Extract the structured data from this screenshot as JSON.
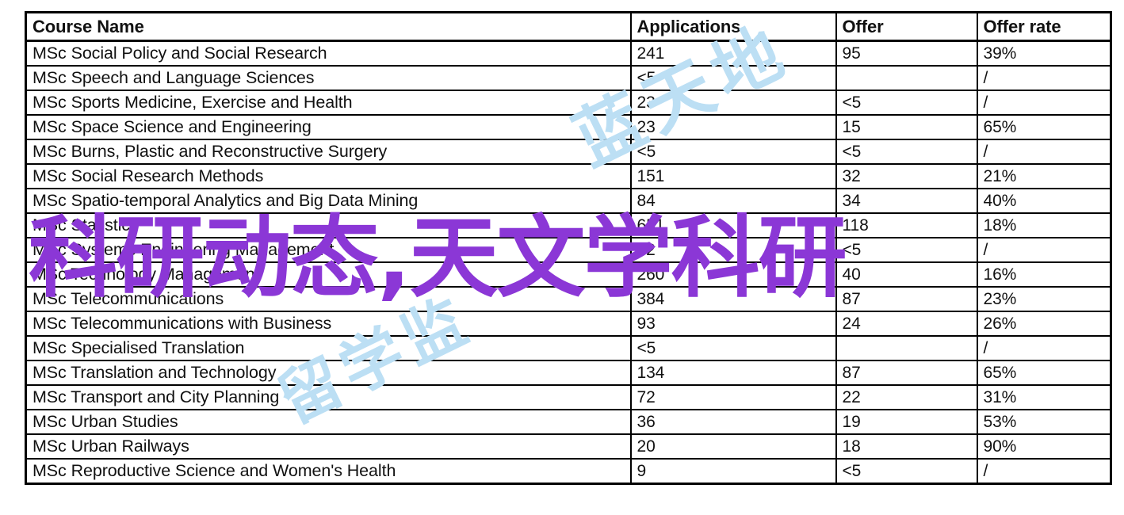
{
  "table": {
    "columns": [
      "Course Name",
      "Applications",
      "Offer",
      "Offer rate"
    ],
    "rows": [
      {
        "name": "MSc Social Policy and Social Research",
        "applications": "241",
        "offer": "95",
        "rate": "39%"
      },
      {
        "name": "MSc Speech and Language Sciences",
        "applications": "<5",
        "offer": "",
        "rate": "/"
      },
      {
        "name": "MSc Sports Medicine, Exercise and Health",
        "applications": "23",
        "offer": "<5",
        "rate": "/"
      },
      {
        "name": "MSc Space Science and Engineering",
        "applications": "23",
        "offer": "15",
        "rate": "65%"
      },
      {
        "name": "MSc Burns, Plastic and Reconstructive Surgery",
        "applications": "<5",
        "offer": "<5",
        "rate": "/"
      },
      {
        "name": "MSc Social Research Methods",
        "applications": "151",
        "offer": "32",
        "rate": "21%"
      },
      {
        "name": "MSc Spatio-temporal Analytics and Big Data Mining",
        "applications": "84",
        "offer": "34",
        "rate": "40%"
      },
      {
        "name": "MSc Statistics",
        "applications": "651",
        "offer": "118",
        "rate": "18%"
      },
      {
        "name": "MSc Systems Engineering Management",
        "applications": "32",
        "offer": "<5",
        "rate": "/"
      },
      {
        "name": "MSc Technology Management",
        "applications": "260",
        "offer": "40",
        "rate": "16%"
      },
      {
        "name": "MSc Telecommunications",
        "applications": "384",
        "offer": "87",
        "rate": "23%"
      },
      {
        "name": "MSc Telecommunications with Business",
        "applications": "93",
        "offer": "24",
        "rate": "26%"
      },
      {
        "name": "MSc Specialised Translation",
        "applications": "<5",
        "offer": "",
        "rate": "/"
      },
      {
        "name": "MSc Translation and Technology",
        "applications": "134",
        "offer": "87",
        "rate": "65%"
      },
      {
        "name": "MSc Transport and City Planning",
        "applications": "72",
        "offer": "22",
        "rate": "31%"
      },
      {
        "name": "MSc Urban Studies",
        "applications": "36",
        "offer": "19",
        "rate": "53%"
      },
      {
        "name": "MSc Urban Railways",
        "applications": "20",
        "offer": "18",
        "rate": "90%"
      },
      {
        "name": "MSc Reproductive Science and Women's Health",
        "applications": "9",
        "offer": "<5",
        "rate": "/"
      }
    ]
  },
  "watermarks": {
    "blue_top": "蓝天地",
    "blue_bottom": "留学监",
    "purple_headline": "科研动态,天文学科研",
    "blue_color": "#bcdff4",
    "purple_color": "#8b37d6"
  }
}
